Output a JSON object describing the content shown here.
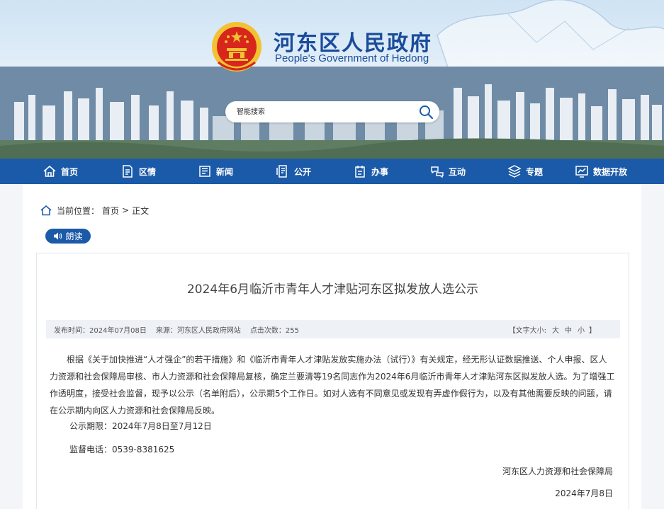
{
  "site": {
    "title": "河东区人民政府",
    "subtitle": "People's Government of Hedong"
  },
  "search": {
    "placeholder": "智能搜索",
    "icon": "search-icon"
  },
  "nav": {
    "items": [
      {
        "label": "首页",
        "icon": "home-icon"
      },
      {
        "label": "区情",
        "icon": "document-icon"
      },
      {
        "label": "新闻",
        "icon": "news-icon"
      },
      {
        "label": "公开",
        "icon": "disclosure-icon"
      },
      {
        "label": "办事",
        "icon": "service-icon"
      },
      {
        "label": "互动",
        "icon": "interaction-icon"
      },
      {
        "label": "专题",
        "icon": "layers-icon"
      },
      {
        "label": "数据开放",
        "icon": "chart-icon"
      }
    ]
  },
  "breadcrumb": {
    "prefix": "当前位置：",
    "home": "首页",
    "separator": ">",
    "current": "正文"
  },
  "read_button": "朗读",
  "article": {
    "title": "2024年6月临沂市青年人才津贴河东区拟发放人选公示",
    "meta": {
      "publish": "发布时间：2024年07月08日",
      "source": "来源：河东区人民政府网站",
      "clicks": "点击次数：255",
      "size_open": "【文字大小:",
      "size_large": "大",
      "size_medium": "中",
      "size_small": "小",
      "size_close": "】"
    },
    "paragraph": "根据《关于加快推进“人才强企”的若干措施》和《临沂市青年人才津贴发放实施办法（试行）》有关规定，经无形认证数据推送、个人申报、区人力资源和社会保障局审核、市人力资源和社会保障局复核，确定兰要清等19名同志作为2024年6月临沂市青年人才津贴河东区拟发放人选。为了增强工作透明度，接受社会监督，现予以公示（名单附后），公示期5个工作日。如对人选有不同意见或发现有弄虚作假行为，以及有其他需要反映的问题，请在公示期内向区人力资源和社会保障局反映。",
    "period": "公示期限：2024年7月8日至7月12日",
    "phone": "监督电话：0539-8381625",
    "signer": "河东区人力资源和社会保障局",
    "date": "2024年7月8日"
  },
  "colors": {
    "nav_bg": "#1b5aa8",
    "title_blue": "#1a4c9a",
    "emblem_red": "#d8261c",
    "emblem_gold": "#f2c232"
  }
}
